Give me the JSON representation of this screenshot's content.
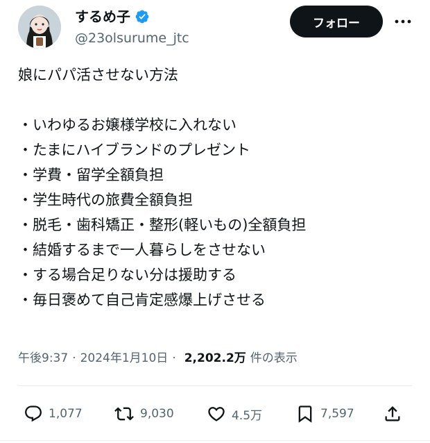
{
  "author": {
    "display_name": "するめ子",
    "handle": "@23olsurume_jtc",
    "verified": true
  },
  "follow_label": "フォロー",
  "tweet": {
    "lines": [
      "娘にパパ活させない方法",
      "",
      "・いわゆるお嬢様学校に入れない",
      "・たまにハイブランドのプレゼント",
      "・学費・留学全額負担",
      "・学生時代の旅費全額負担",
      "・脱毛・歯科矯正・整形(軽いもの)全額負担",
      "・結婚するまで一人暮らしをさせない",
      "・する場合足りない分は援助する",
      "・毎日褒めて自己肯定感爆上げさせる"
    ]
  },
  "meta": {
    "time": "午後9:37",
    "date": "2024年1月10日",
    "views": "2,202.2万",
    "views_label": "件の表示"
  },
  "actions": {
    "replies": "1,077",
    "reposts": "9,030",
    "likes": "4.5万",
    "bookmarks": "7,597"
  },
  "colors": {
    "verified": "#1d9bf0",
    "text": "#0f1419",
    "secondary": "#536471",
    "follow_bg": "#0f1419"
  }
}
